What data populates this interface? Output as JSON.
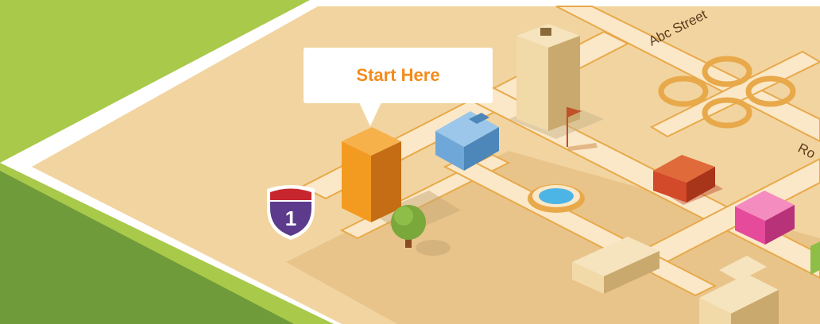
{
  "callout": {
    "label": "Start Here"
  },
  "shield": {
    "number": "1"
  },
  "streets": {
    "abc": "Abc Street",
    "partial": "Ro"
  },
  "colors": {
    "grass": "#a9c94a",
    "grass_shadow": "#6f9b3a",
    "ground": "#f2d4a0",
    "ground_dark": "#e9c48a",
    "road": "#fbe8c8",
    "road_edge": "#e8a94a",
    "orange_building": "#f39a21",
    "blue_building": "#6fa8d8",
    "red_house": "#d24a2a",
    "pink_building": "#e64a9a",
    "tan_building": "#f1d9a8",
    "callout_text": "#f28c1c",
    "shield_purple": "#5c3a8c",
    "shield_red": "#c8262f"
  },
  "icons": {
    "shield": "interstate-shield-icon",
    "flag": "flag-icon",
    "tree": "tree-icon",
    "fountain": "fountain-icon"
  }
}
